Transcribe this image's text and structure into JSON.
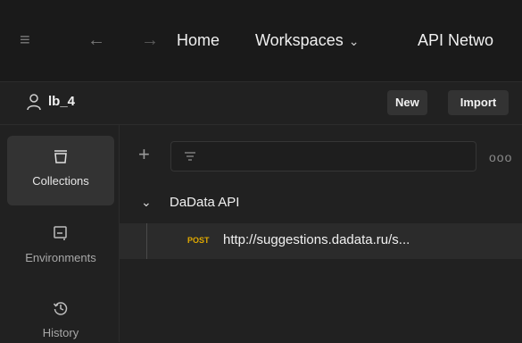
{
  "topbar": {
    "menu_icon": "hamburger-icon",
    "back_icon": "arrow-left-icon",
    "forward_icon": "arrow-right-icon",
    "home_label": "Home",
    "workspaces_label": "Workspaces",
    "api_network_label": "API Netwo"
  },
  "workspace": {
    "user_icon": "user-icon",
    "name": "lb_4",
    "new_label": "New",
    "import_label": "Import"
  },
  "rail": {
    "items": [
      {
        "label": "Collections",
        "icon": "collections-icon",
        "active": true
      },
      {
        "label": "Environments",
        "icon": "environments-icon",
        "active": false
      },
      {
        "label": "History",
        "icon": "history-icon",
        "active": false
      }
    ]
  },
  "sidebar": {
    "add_icon": "plus-icon",
    "filter_icon": "filter-icon",
    "more_icon": "more-icon",
    "collection": {
      "name": "DaData API",
      "request": {
        "method": "POST",
        "name": "http://suggestions.dadata.ru/s..."
      }
    }
  },
  "colors": {
    "background": "#212121",
    "topbar": "#1a1a1a",
    "post_method": "#e0a900"
  }
}
